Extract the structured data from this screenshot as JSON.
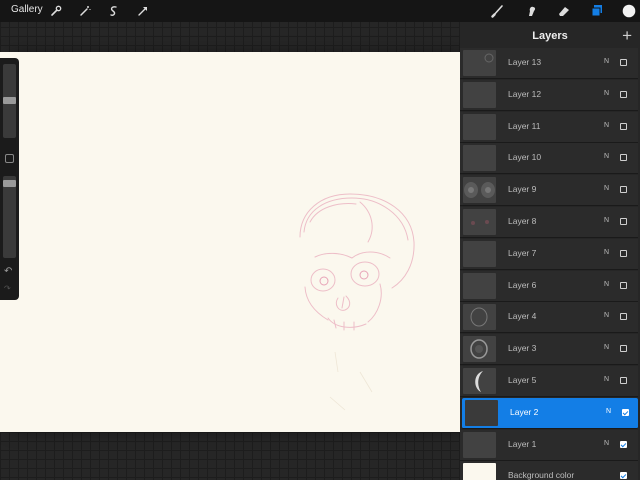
{
  "topbar": {
    "gallery_label": "Gallery",
    "left_tools": [
      "wrench-icon",
      "magic-wand-icon",
      "selection-icon",
      "transform-icon"
    ],
    "right_tools": [
      "brush-icon",
      "smudge-icon",
      "eraser-icon",
      "layers-icon",
      "color-icon"
    ],
    "active_tool": "layers-icon",
    "current_color": "#f2f2f2",
    "accent": "#137ee6"
  },
  "sidebar": {
    "brush_size_level": 0.25,
    "opacity_level": 0.05
  },
  "layers_panel": {
    "title": "Layers",
    "add_label": "+",
    "layers": [
      {
        "name": "Layer 13",
        "mode": "N",
        "visible": false,
        "selected": false
      },
      {
        "name": "Layer 12",
        "mode": "N",
        "visible": false,
        "selected": false
      },
      {
        "name": "Layer 11",
        "mode": "N",
        "visible": false,
        "selected": false
      },
      {
        "name": "Layer 10",
        "mode": "N",
        "visible": false,
        "selected": false
      },
      {
        "name": "Layer 9",
        "mode": "N",
        "visible": false,
        "selected": false
      },
      {
        "name": "Layer 8",
        "mode": "N",
        "visible": false,
        "selected": false
      },
      {
        "name": "Layer 7",
        "mode": "N",
        "visible": false,
        "selected": false
      },
      {
        "name": "Layer 6",
        "mode": "N",
        "visible": false,
        "selected": false
      },
      {
        "name": "Layer 4",
        "mode": "N",
        "visible": false,
        "selected": false
      },
      {
        "name": "Layer 3",
        "mode": "N",
        "visible": false,
        "selected": false
      },
      {
        "name": "Layer 5",
        "mode": "N",
        "visible": false,
        "selected": false
      },
      {
        "name": "Layer 2",
        "mode": "N",
        "visible": true,
        "selected": true
      },
      {
        "name": "Layer 1",
        "mode": "N",
        "visible": true,
        "selected": false
      },
      {
        "name": "Background color",
        "mode": "",
        "visible": true,
        "selected": false,
        "background": true
      }
    ]
  }
}
